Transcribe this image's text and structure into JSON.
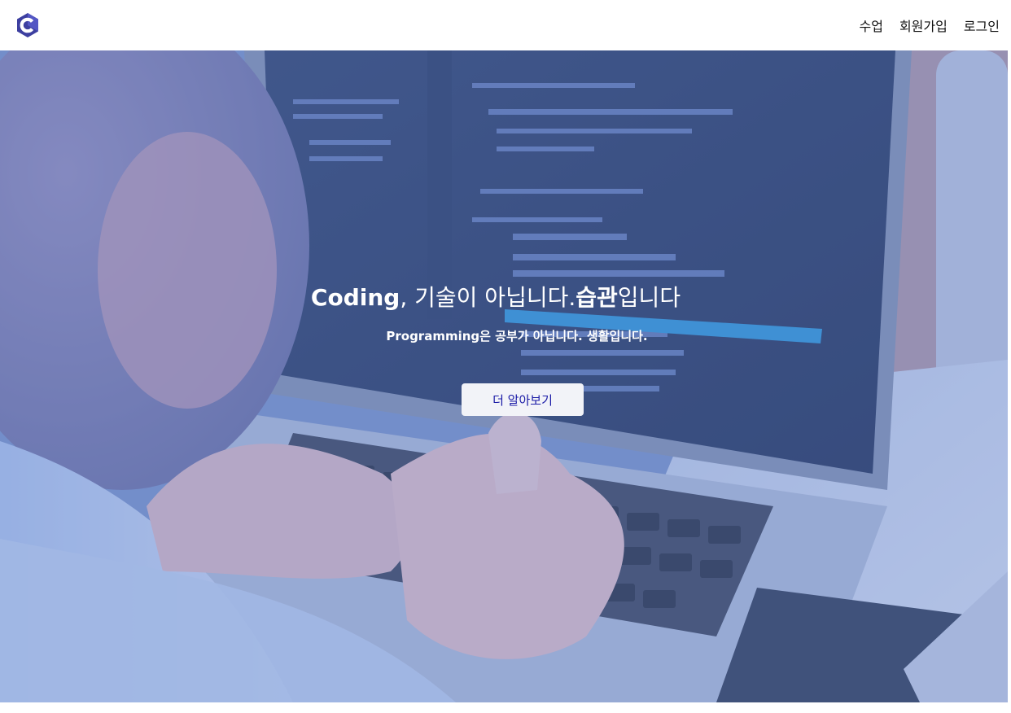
{
  "header": {
    "logo_icon": "c-hexagon-logo-icon",
    "logo_color": "#3d3fa0",
    "nav": [
      {
        "label": "수업"
      },
      {
        "label": "회원가입"
      },
      {
        "label": "로그인"
      }
    ]
  },
  "hero": {
    "headline": {
      "part1": "Coding",
      "part2": ", 기술이 아닙니다.",
      "part3": "습관",
      "part4": "입니다"
    },
    "subline": {
      "part1": "Programming",
      "part2": "은 공부가 아닙니다. 생활입니다."
    },
    "cta_label": "더 알아보기",
    "overlay_color": "#6080cd",
    "cta_text_color": "#1a1aa6"
  }
}
